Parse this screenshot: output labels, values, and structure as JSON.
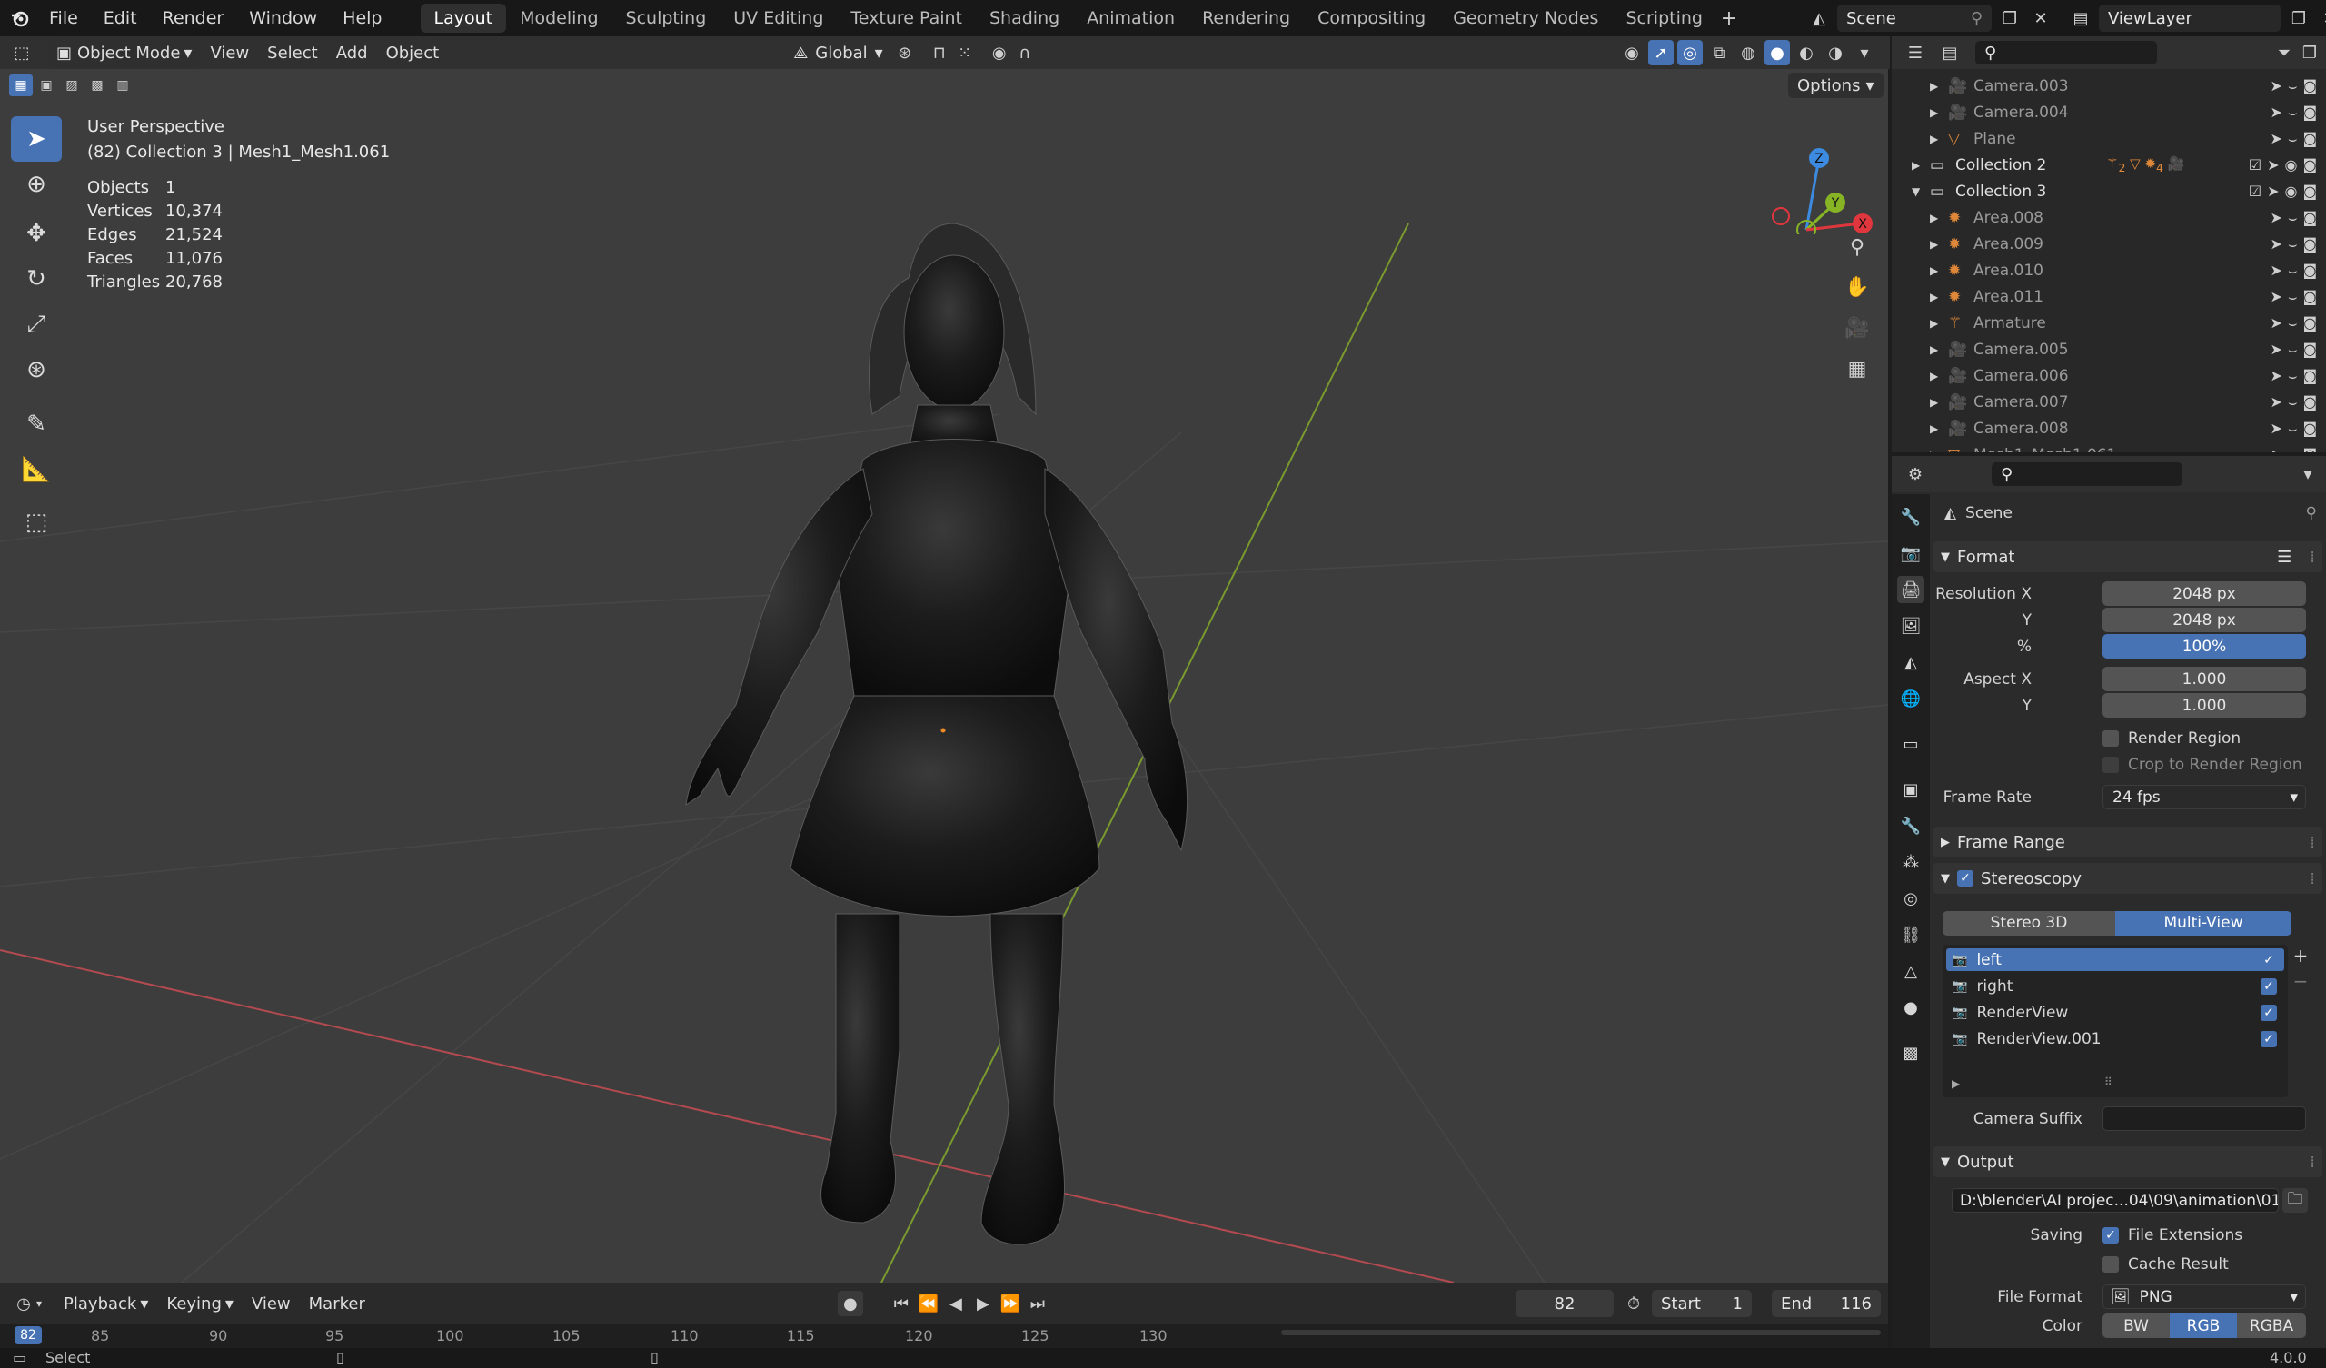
{
  "topbar": {
    "menus": [
      "File",
      "Edit",
      "Render",
      "Window",
      "Help"
    ],
    "workspaces": [
      "Layout",
      "Modeling",
      "Sculpting",
      "UV Editing",
      "Texture Paint",
      "Shading",
      "Animation",
      "Rendering",
      "Compositing",
      "Geometry Nodes",
      "Scripting"
    ],
    "active_workspace": "Layout",
    "scene": "Scene",
    "view_layer": "ViewLayer"
  },
  "viewport_header": {
    "mode": "Object Mode",
    "menus": [
      "View",
      "Select",
      "Add",
      "Object"
    ],
    "orientation": "Global",
    "options": "Options"
  },
  "viewport": {
    "view_name": "User Perspective",
    "context": "(82) Collection 3 | Mesh1_Mesh1.061",
    "stats": [
      {
        "label": "Objects",
        "value": "1"
      },
      {
        "label": "Vertices",
        "value": "10,374"
      },
      {
        "label": "Edges",
        "value": "21,524"
      },
      {
        "label": "Faces",
        "value": "11,076"
      },
      {
        "label": "Triangles",
        "value": "20,768"
      }
    ],
    "gizmo": {
      "z": "Z",
      "y": "Y",
      "x": "X"
    }
  },
  "timeline": {
    "menus": [
      "Playback",
      "Keying",
      "View",
      "Marker"
    ],
    "current_frame": "82",
    "start_label": "Start",
    "start": "1",
    "end_label": "End",
    "end": "116",
    "ruler": [
      "82",
      "85",
      "90",
      "95",
      "100",
      "105",
      "110",
      "115",
      "120",
      "125",
      "130"
    ]
  },
  "status": {
    "select": "Select",
    "version": "4.0.0"
  },
  "outliner": {
    "rows": [
      {
        "name": "Camera.003",
        "indent": 2,
        "dim": true
      },
      {
        "name": "Camera.004",
        "indent": 2,
        "dim": true
      },
      {
        "name": "Plane",
        "indent": 2,
        "dim": true
      },
      {
        "name": "Collection 2",
        "indent": 1,
        "dim": false
      },
      {
        "name": "Collection 3",
        "indent": 1,
        "dim": false
      },
      {
        "name": "Area.008",
        "indent": 2,
        "dim": true
      },
      {
        "name": "Area.009",
        "indent": 2,
        "dim": true
      },
      {
        "name": "Area.010",
        "indent": 2,
        "dim": true
      },
      {
        "name": "Area.011",
        "indent": 2,
        "dim": true
      },
      {
        "name": "Armature",
        "indent": 2,
        "dim": true
      },
      {
        "name": "Camera.005",
        "indent": 2,
        "dim": true
      },
      {
        "name": "Camera.006",
        "indent": 2,
        "dim": true
      },
      {
        "name": "Camera.007",
        "indent": 2,
        "dim": true
      },
      {
        "name": "Camera.008",
        "indent": 2,
        "dim": true
      },
      {
        "name": "Mesh1_Mesh1.061",
        "indent": 2,
        "dim": true
      }
    ],
    "collection2_badges": [
      "2",
      "4"
    ]
  },
  "properties": {
    "context": "Scene",
    "format": {
      "title": "Format",
      "res_x_label": "Resolution X",
      "res_x": "2048 px",
      "res_y_label": "Y",
      "res_y": "2048 px",
      "pct_label": "%",
      "pct": "100%",
      "aspect_x_label": "Aspect X",
      "aspect_x": "1.000",
      "aspect_y_label": "Y",
      "aspect_y": "1.000",
      "render_region": "Render Region",
      "crop": "Crop to Render Region",
      "frame_rate_label": "Frame Rate",
      "frame_rate": "24 fps"
    },
    "frame_range": "Frame Range",
    "stereoscopy": {
      "title": "Stereoscopy",
      "mode_a": "Stereo 3D",
      "mode_b": "Multi-View",
      "views": [
        "left",
        "right",
        "RenderView",
        "RenderView.001"
      ],
      "camera_suffix_label": "Camera Suffix"
    },
    "output": {
      "title": "Output",
      "path": "D:\\blender\\AI projec...04\\09\\animation\\01",
      "saving_label": "Saving",
      "file_ext": "File Extensions",
      "cache": "Cache Result",
      "file_format_label": "File Format",
      "file_format": "PNG",
      "color_label": "Color",
      "color_modes": [
        "BW",
        "RGB",
        "RGBA"
      ]
    }
  },
  "colors": {
    "accent": "#4772b3",
    "viewport": "#3d3d3d",
    "x_axis": "#e0363d",
    "y_axis": "#86b425",
    "z_axis": "#3d8be0"
  }
}
